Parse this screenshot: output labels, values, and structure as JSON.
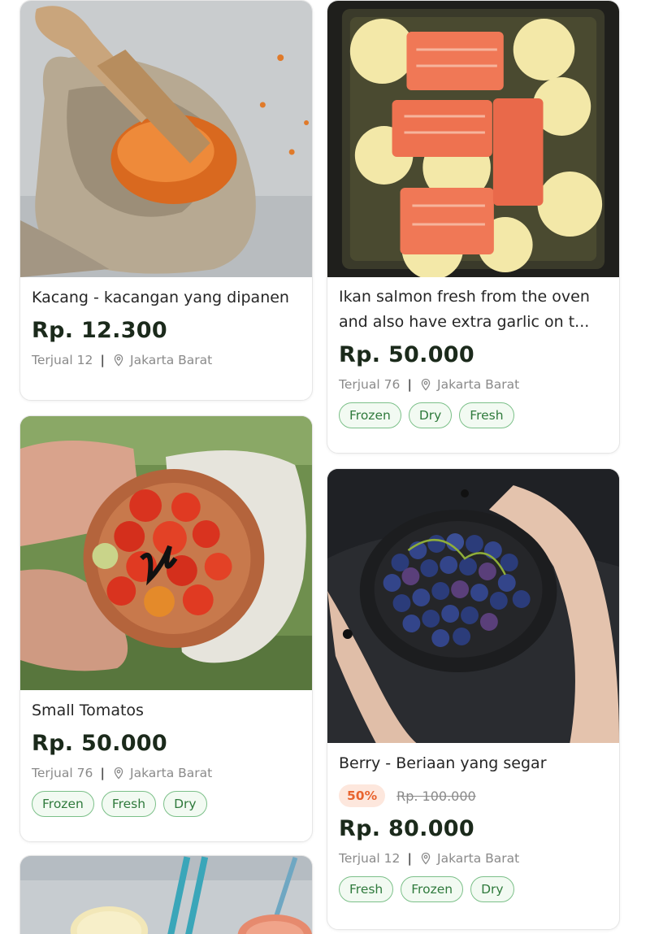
{
  "products": [
    {
      "title": "Kacang - kacangan yang dipanen",
      "price": "Rp. 12.300",
      "sold": "Terjual 12",
      "location": "Jakarta Barat",
      "tags": [],
      "image": "red-lentils-sack"
    },
    {
      "title": "Ikan salmon fresh from the oven and also have extra garlic on t...",
      "price": "Rp. 50.000",
      "sold": "Terjual 76",
      "location": "Jakarta Barat",
      "tags": [
        "Frozen",
        "Dry",
        "Fresh"
      ],
      "image": "baked-salmon-tray"
    },
    {
      "title": "Small Tomatos",
      "price": "Rp. 50.000",
      "sold": "Terjual 76",
      "location": "Jakarta Barat",
      "tags": [
        "Frozen",
        "Fresh",
        "Dry"
      ],
      "image": "cherry-tomatoes-bowl"
    },
    {
      "title": "Berry - Beriaan yang segar",
      "discount": "50%",
      "old_price": "Rp. 100.000",
      "price": "Rp. 80.000",
      "sold": "Terjual 12",
      "location": "Jakarta Barat",
      "tags": [
        "Fresh",
        "Frozen",
        "Dry"
      ],
      "image": "blueberries-bowl"
    },
    {
      "title": "",
      "image": "citrus-drinks"
    }
  ],
  "colors": {
    "tag_text": "#2f7a3c",
    "tag_border": "#7cc089",
    "discount_text": "#e8632e",
    "discount_bg": "#fde7dd",
    "price": "#1b2a1b"
  }
}
